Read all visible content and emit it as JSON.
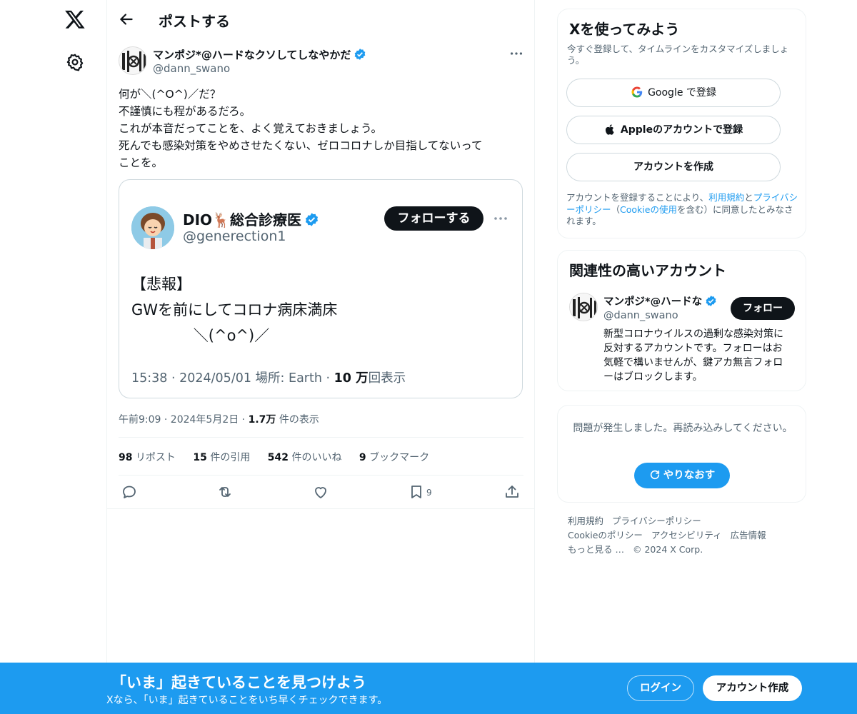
{
  "header": {
    "title": "ポストする"
  },
  "post": {
    "author_name": "マンポジ*@ハードなクソしてしなやかだ",
    "author_handle": "@dann_swano",
    "text_lines": [
      "何が＼(^O^)／だ？",
      "不謹慎にも程があるだろ。",
      "これが本音だってことを、よく覚えておきましょう。",
      "死んでも感染対策をやめさせたくない、ゼロコロナしか目指してないって",
      "ことを。"
    ],
    "embed": {
      "name": "DIO🦌総合診療医",
      "handle": "@generection1",
      "follow_label": "フォローする",
      "text_lines": [
        "【悲報】",
        "GWを前にしてコロナ病床満床",
        "             ＼(^o^)／"
      ],
      "meta_prefix": "15:38 · 2024/05/01 場所: Earth · ",
      "views_count": "10 万",
      "views_suffix": "回表示"
    },
    "timestamp": "午前9:09 · 2024年5月2日 · ",
    "views_count": "1.7万",
    "views_label": " 件の表示",
    "stats": [
      {
        "count": "98",
        "label": " リポスト"
      },
      {
        "count": "15",
        "label": " 件の引用"
      },
      {
        "count": "542",
        "label": " 件のいいね"
      },
      {
        "count": "9",
        "label": " ブックマーク"
      }
    ],
    "bookmark_count": "9"
  },
  "signup": {
    "title": "Xを使ってみよう",
    "subtitle": "今すぐ登録して、タイムラインをカスタマイズしましょう。",
    "google_label": "Google で登録",
    "apple_label": "Appleのアカウントで登録",
    "create_label": "アカウントを作成",
    "terms_1": "アカウントを登録することにより、",
    "terms_link_1": "利用規約",
    "terms_2": "と",
    "terms_link_2": "プライバシーポリシー",
    "terms_3": "（",
    "terms_link_3": "Cookieの使用",
    "terms_4": "を含む）に同意したとみなされます。"
  },
  "related": {
    "title": "関連性の高いアカウント",
    "name": "マンポジ*@ハードな",
    "handle": "@dann_swano",
    "follow_label": "フォロー",
    "bio": "新型コロナウイルスの過剰な感染対策に反対するアカウントです。フォローはお気軽で構いませんが、鍵アカ無言フォローはブロックします。"
  },
  "error_card": {
    "message": "問題が発生しました。再読み込みしてください。",
    "retry_label": "やりなおす"
  },
  "footer": {
    "links": [
      "利用規約",
      "プライバシーポリシー",
      "Cookieのポリシー",
      "アクセシビリティ",
      "広告情報",
      "もっと見る …",
      "© 2024 X Corp."
    ]
  },
  "banner": {
    "title": "「いま」起きていることを見つけよう",
    "subtitle": "Xなら、「いま」起きていることをいち早くチェックできます。",
    "login_label": "ログイン",
    "create_label": "アカウント作成"
  },
  "colors": {
    "accent": "#1d9bf0",
    "text": "#0f1419",
    "muted": "#536471",
    "border": "#eff3f4"
  },
  "icons": [
    "x-logo-icon",
    "gear-icon",
    "back-arrow-icon",
    "verified-icon",
    "more-icon",
    "reply-icon",
    "repost-icon",
    "like-icon",
    "bookmark-icon",
    "share-icon",
    "google-icon",
    "apple-icon",
    "refresh-icon"
  ]
}
